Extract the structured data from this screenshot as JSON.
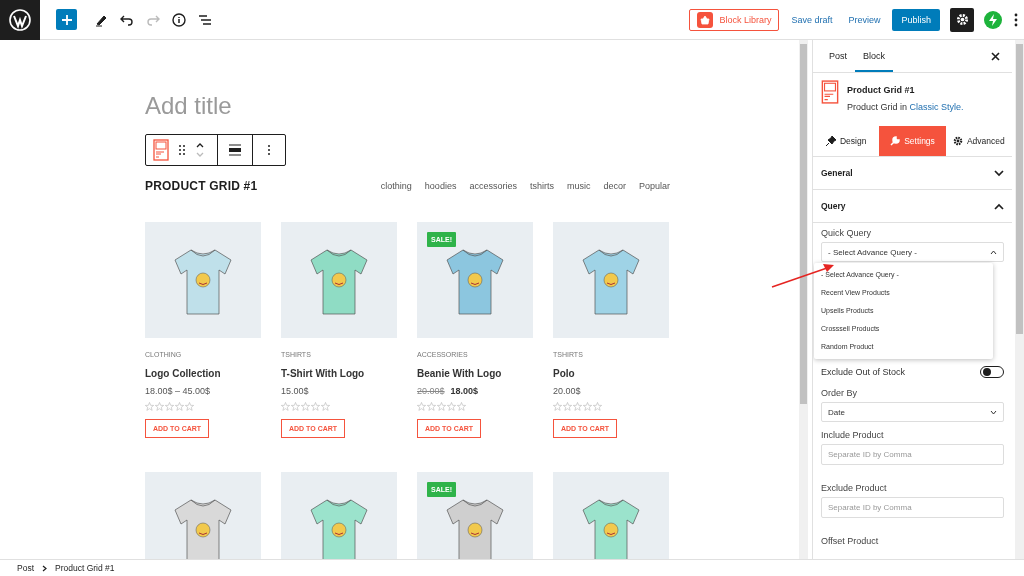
{
  "toolbar": {
    "block_library": "Block Library",
    "save_draft": "Save draft",
    "preview": "Preview",
    "publish": "Publish",
    "settings_selected": true
  },
  "editor": {
    "title_placeholder": "Add title",
    "grid_title": "PRODUCT GRID #1",
    "filters": [
      {
        "label": "clothing",
        "selected": false
      },
      {
        "label": "hoodies",
        "selected": false
      },
      {
        "label": "accessories",
        "selected": false
      },
      {
        "label": "tshirts",
        "selected": false
      },
      {
        "label": "music",
        "selected": false
      },
      {
        "label": "decor",
        "selected": false
      },
      {
        "label": "Popular",
        "selected": false
      }
    ],
    "products": [
      {
        "category": "CLOTHING",
        "name": "Logo Collection",
        "price": "18.00$ – 45.00$",
        "sale": false,
        "stars": 0,
        "button": "ADD TO CART"
      },
      {
        "category": "TSHIRTS",
        "name": "T-Shirt With Logo",
        "price": "15.00$",
        "sale": false,
        "stars": 0,
        "button": "ADD TO CART"
      },
      {
        "category": "ACCESSORIES",
        "name": "Beanie With Logo",
        "old_price": "20.00$",
        "price": "18.00$",
        "sale": true,
        "sale_label": "SALE!",
        "stars": 0,
        "button": "ADD TO CART"
      },
      {
        "category": "TSHIRTS",
        "name": "Polo",
        "price": "20.00$",
        "sale": false,
        "stars": 0,
        "button": "ADD TO CART"
      },
      {
        "sale": false
      },
      {
        "sale": false
      },
      {
        "sale": true,
        "sale_label": "SALE!"
      },
      {
        "sale": false
      }
    ]
  },
  "sidebar": {
    "tabs": [
      {
        "label": "Post",
        "selected": false
      },
      {
        "label": "Block",
        "selected": true
      }
    ],
    "block": {
      "title": "Product Grid #1",
      "description": "Product Grid in",
      "style_link": "Classic Style."
    },
    "subtabs": [
      {
        "label": "Design",
        "selected": false
      },
      {
        "label": "Settings",
        "selected": true
      },
      {
        "label": "Advanced",
        "selected": false
      }
    ],
    "sections": [
      {
        "title": "General",
        "expanded": false
      },
      {
        "title": "Query",
        "expanded": true
      }
    ],
    "quick_query": {
      "label": "Quick Query",
      "value": "- Select Advance Query -",
      "open": true,
      "options": [
        "- Select Advance Query -",
        "Recent View Products",
        "Upsells Products",
        "Crosssell Products",
        "Random Product"
      ]
    },
    "exclude_out_of_stock": {
      "label": "Exclude Out of Stock",
      "on": false
    },
    "order_by": {
      "label": "Order By",
      "value": "Date"
    },
    "include_product": {
      "label": "Include Product",
      "placeholder": "Separate ID by Comma"
    },
    "exclude_product": {
      "label": "Exclude Product",
      "placeholder": "Separate ID by Comma"
    },
    "offset_product": {
      "label": "Offset Product"
    }
  },
  "breadcrumb": [
    "Post",
    "Product Grid #1"
  ]
}
